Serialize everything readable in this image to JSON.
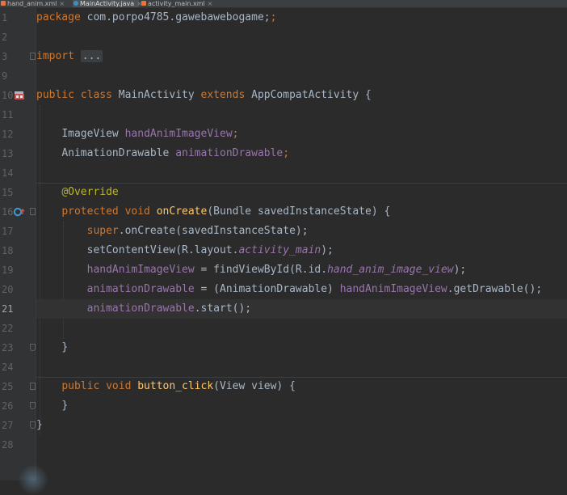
{
  "tabs": [
    {
      "label": "hand_anim.xml",
      "close": "×",
      "icon": "xml-file-icon",
      "active": false
    },
    {
      "label": "MainActivity.java",
      "close": "×",
      "icon": "java-class-icon",
      "active": true
    },
    {
      "label": "activity_main.xml",
      "close": "×",
      "icon": "xml-file-icon",
      "active": false
    }
  ],
  "line_numbers": [
    "1",
    "2",
    "3",
    "9",
    "10",
    "11",
    "12",
    "13",
    "14",
    "15",
    "16",
    "17",
    "18",
    "19",
    "20",
    "21",
    "22",
    "23",
    "24",
    "25",
    "26",
    "27",
    "28"
  ],
  "code": {
    "l1": {
      "kw": "package",
      "rest": " com.porpo4785.gawebawebogame;"
    },
    "l3": {
      "kw": "import",
      "fold": "..."
    },
    "l10": {
      "kw1": "public class",
      "cls": " MainActivity ",
      "kw2": "extends",
      "rest": " AppCompatActivity {"
    },
    "l12": {
      "type": "ImageView ",
      "field": "handAnimImageView",
      "end": ";"
    },
    "l13": {
      "type": "AnimationDrawable ",
      "field": "animationDrawable",
      "end": ";"
    },
    "l15": {
      "annotation": "@Override"
    },
    "l16": {
      "kw": "protected void ",
      "method": "onCreate",
      "rest": "(Bundle savedInstanceState) {"
    },
    "l17": {
      "kw": "super",
      "rest": ".onCreate(savedInstanceState);"
    },
    "l18": {
      "pre": "setContentView(R.layout.",
      "field": "activity_main",
      "post": ");"
    },
    "l19": {
      "field": "handAnimImageView",
      "mid": " = findViewById(R.id.",
      "field2": "hand_anim_image_view",
      "post": ");"
    },
    "l20": {
      "field": "animationDrawable",
      "mid": " = (AnimationDrawable) ",
      "field2": "handAnimImageView",
      "post": ".getDrawable();"
    },
    "l21": {
      "field": "animationDrawable",
      "post": ".start();"
    },
    "l23": {
      "text": "}"
    },
    "l25": {
      "kw": "public void ",
      "method": "button_click",
      "rest": "(View view) {"
    },
    "l26": {
      "text": "}"
    },
    "l27": {
      "text": "}"
    }
  },
  "colors": {
    "background": "#2b2b2b",
    "gutter": "#313335",
    "keyword": "#cc7832",
    "field": "#9876aa",
    "annotation": "#bbb529",
    "method": "#ffc66d",
    "text": "#a9b7c6"
  }
}
